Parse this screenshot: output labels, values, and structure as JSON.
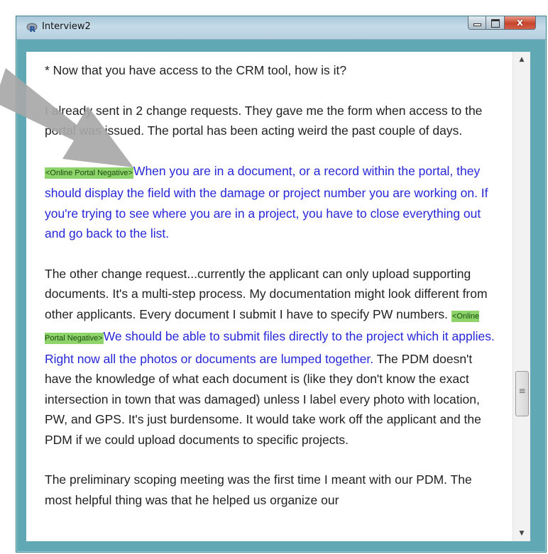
{
  "window": {
    "title": "Interview2",
    "app_icon": "r-icon",
    "close_glyph": "x"
  },
  "scrollbar": {
    "up_glyph": "▲",
    "down_glyph": "▼",
    "thumb_glyph": "≡",
    "position": 0.62
  },
  "document": {
    "p1": "* Now that you have access to the CRM tool, how is it?",
    "p2": "I already sent in 2 change requests.  They gave me the form when access to the portal was issued.  The portal has been acting weird the past couple of days.",
    "p3_tag": "<Online Portal Negative>",
    "p3_text": "When you are in a document, or a record within the portal, they should display the field with the damage or project number you are working on.  If you're trying to see where you are in a project, you have to close everything out and go back to the list.",
    "p4_a": "The other change request...currently the applicant can only upload supporting documents.  It's a multi-step process.  My documentation might look different from other applicants.  Every document I submit I have to specify PW numbers.  ",
    "p4_tag": "<Online Portal Negative>",
    "p4_blue": "We should be able to submit files directly to the project which it applies.  Right now all the photos or documents are lumped together.",
    "p4_b": "  The PDM doesn't have the knowledge of what each document is (like they don't know the exact intersection in town that was damaged) unless I label every photo with location, PW, and GPS.  It's just burdensome.  It would take work off the applicant and the PDM if we could upload documents to specific projects.",
    "p5": "The preliminary scoping meeting was the first time I meant with our PDM.  The most helpful thing was that he helped us organize our"
  },
  "colors": {
    "frame": "#5fa8b4",
    "coded_text": "#2727d8",
    "tag_bg": "#8ed46b",
    "arrow": "#a8a8a8"
  }
}
